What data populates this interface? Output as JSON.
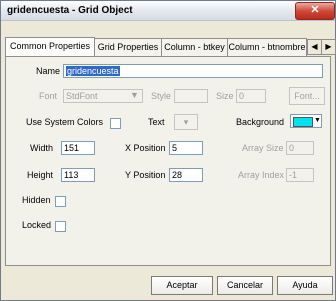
{
  "window": {
    "title": "gridencuesta - Grid Object",
    "close_glyph": "✕"
  },
  "tabs": [
    {
      "label": "Common Properties"
    },
    {
      "label": "Grid Properties"
    },
    {
      "label": "Column - btkey"
    },
    {
      "label": "Column - btnombre"
    }
  ],
  "tab_nav": {
    "prev": "◀",
    "next": "▶"
  },
  "props": {
    "name_label": "Name",
    "name_value": "gridencuesta",
    "font_label": "Font",
    "font_value": "StdFont",
    "style_label": "Style",
    "style_value": "",
    "size_label": "Size",
    "size_value": "0",
    "font_button": "Font...",
    "use_system_colors_label": "Use System Colors",
    "text_label": "Text",
    "background_label": "Background",
    "background_color": "#00e3ef",
    "width_label": "Width",
    "width_value": "151",
    "xpos_label": "X Position",
    "xpos_value": "5",
    "array_size_label": "Array Size",
    "array_size_value": "0",
    "height_label": "Height",
    "height_value": "113",
    "ypos_label": "Y Position",
    "ypos_value": "28",
    "array_index_label": "Array Index",
    "array_index_value": "-1",
    "hidden_label": "Hidden",
    "locked_label": "Locked"
  },
  "buttons": {
    "accept": "Aceptar",
    "cancel": "Cancelar",
    "help": "Ayuda"
  }
}
